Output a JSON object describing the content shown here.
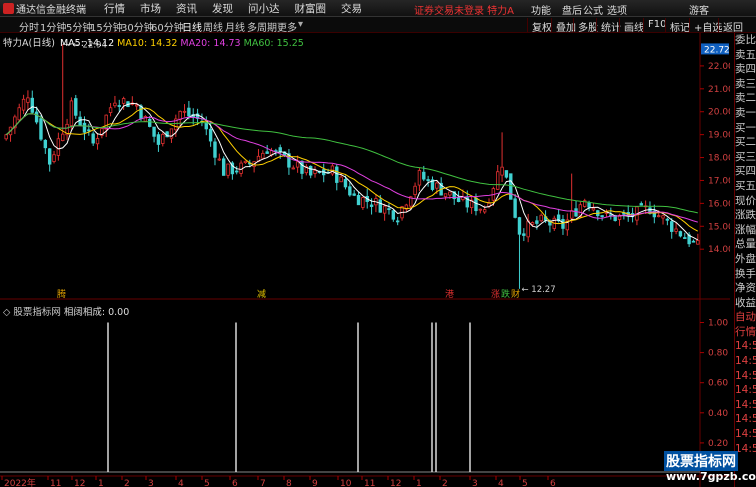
{
  "app": {
    "title": "通达信金融终端"
  },
  "menu": [
    "行情",
    "市场",
    "资讯",
    "发现",
    "问小达",
    "财富圈",
    "交易"
  ],
  "notice": "证券交易未登录 特力A",
  "right_menu": [
    "功能",
    "盘后",
    "公式",
    "选项",
    "游客"
  ],
  "periods": [
    "分时",
    "1分钟",
    "5分钟",
    "15分钟",
    "30分钟",
    "60分钟",
    "日线",
    "周线",
    "月线",
    "多周期",
    "更多"
  ],
  "active_period": "日线",
  "tools": [
    "复权",
    "叠加",
    "多股",
    "统计",
    "画线",
    "F10",
    "标记",
    "+自选",
    "返回"
  ],
  "stock": {
    "name": "特力A",
    "period": "(日线)",
    "ma5": "MA5: 14.12",
    "ma10": "MA10: 14.32",
    "ma20": "MA20: 14.73",
    "ma60": "MA60: 15.25"
  },
  "colors": {
    "ma5": "#ffffff",
    "ma10": "#ffd000",
    "ma20": "#e040e0",
    "ma60": "#40c040",
    "up": "#e03030",
    "down": "#40d0d0"
  },
  "price_axis": [
    "22.00",
    "21.00",
    "20.00",
    "19.00",
    "18.00",
    "17.00",
    "16.00",
    "15.00",
    "14.00"
  ],
  "current_price": "22.72",
  "high_label": "22.94",
  "low_label": "12.27",
  "markers": [
    {
      "text": "腾",
      "color": "#e0a000"
    },
    {
      "text": "减",
      "color": "#e0c000"
    },
    {
      "text": "港",
      "color": "#e03030"
    },
    {
      "text": "涨",
      "color": "#e03030"
    },
    {
      "text": "跌",
      "color": "#40c040"
    },
    {
      "text": "财",
      "color": "#e0a000"
    }
  ],
  "indicator": {
    "name": "股票指标网",
    "label": "相阔相成: 0.00"
  },
  "indicator_axis": [
    "1.00",
    "0.80",
    "0.60",
    "0.40",
    "0.20"
  ],
  "indicator_spikes": [
    0.1,
    0.22,
    0.44,
    0.56,
    0.82,
    0.94
  ],
  "date_axis": [
    "2022年",
    "11",
    "12",
    "1",
    "2",
    "3",
    "4",
    "5",
    "6",
    "7",
    "8",
    "9",
    "10",
    "11",
    "12",
    "1",
    "2",
    "3",
    "4",
    "5",
    "6"
  ],
  "right_panel": [
    "委比",
    "卖五",
    "卖四",
    "卖三",
    "卖二",
    "卖一",
    "买一",
    "买二",
    "买三",
    "买四",
    "买五",
    "现价",
    "涨跌",
    "涨幅",
    "总量",
    "外盘",
    "换手",
    "净资",
    "收益",
    "自动",
    "行情",
    "14:5",
    "14:5",
    "14:5",
    "14:5",
    "14:5",
    "14:5",
    "14:5",
    "14:5"
  ],
  "watermark": {
    "line1": "股票指标网",
    "line2": "www.7gpzb.com"
  }
}
